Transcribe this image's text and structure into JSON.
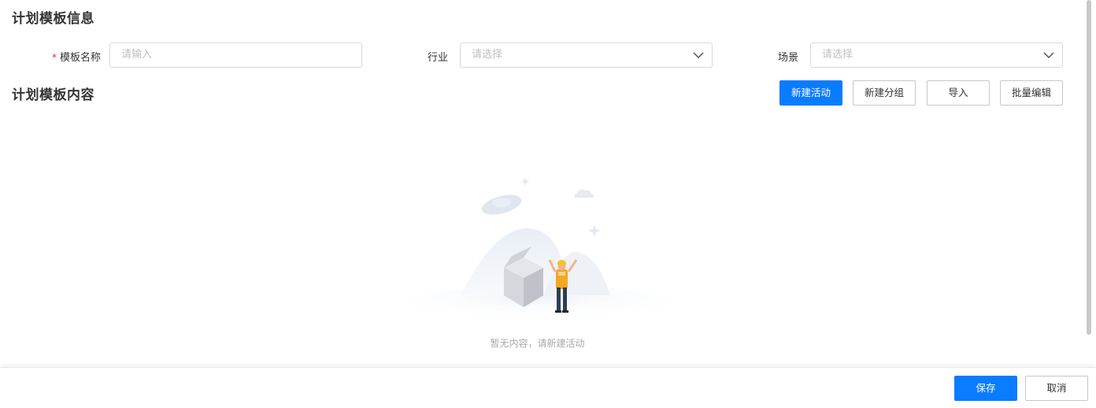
{
  "info_section": {
    "title": "计划模板信息",
    "fields": {
      "template_name": {
        "required_mark": "*",
        "label": "模板名称",
        "placeholder": "请输入"
      },
      "industry": {
        "label": "行业",
        "placeholder": "请选择"
      },
      "scene": {
        "label": "场景",
        "placeholder": "请选择"
      }
    }
  },
  "content_section": {
    "title": "计划模板内容",
    "buttons": {
      "new_activity": "新建活动",
      "new_group": "新建分组",
      "import": "导入",
      "batch_edit": "批量编辑"
    },
    "empty_text": "暂无内容，请新建活动"
  },
  "footer": {
    "save": "保存",
    "cancel": "取消"
  },
  "colors": {
    "primary": "#0a7cff",
    "required": "#f5222d"
  },
  "icons": [
    "chevron-down-icon",
    "empty-state-illustration"
  ]
}
